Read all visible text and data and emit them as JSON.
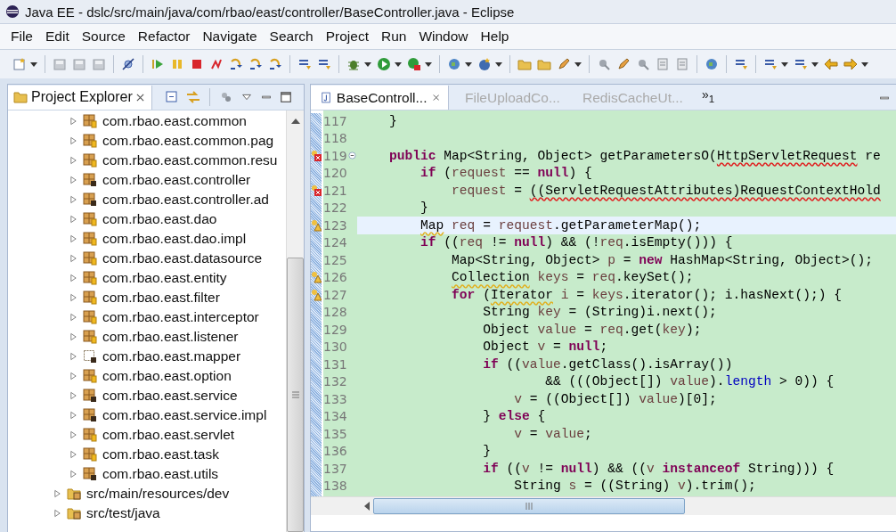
{
  "window": {
    "title": "Java EE - dslc/src/main/java/com/rbao/east/controller/BaseController.java - Eclipse"
  },
  "menu": [
    "File",
    "Edit",
    "Source",
    "Refactor",
    "Navigate",
    "Search",
    "Project",
    "Run",
    "Window",
    "Help"
  ],
  "left_panel": {
    "tab": {
      "label": "Project Explorer",
      "selected": true
    },
    "packages": [
      {
        "label": "com.rbao.east.common",
        "kind": "package",
        "expanded": false
      },
      {
        "label": "com.rbao.east.common.pag",
        "kind": "package",
        "expanded": false
      },
      {
        "label": "com.rbao.east.common.resu",
        "kind": "package",
        "expanded": false
      },
      {
        "label": "com.rbao.east.controller",
        "kind": "package-marked",
        "expanded": false
      },
      {
        "label": "com.rbao.east.controller.ad",
        "kind": "package-marked",
        "expanded": false
      },
      {
        "label": "com.rbao.east.dao",
        "kind": "package",
        "expanded": false
      },
      {
        "label": "com.rbao.east.dao.impl",
        "kind": "package",
        "expanded": false
      },
      {
        "label": "com.rbao.east.datasource",
        "kind": "package",
        "expanded": false
      },
      {
        "label": "com.rbao.east.entity",
        "kind": "package",
        "expanded": false
      },
      {
        "label": "com.rbao.east.filter",
        "kind": "package",
        "expanded": false
      },
      {
        "label": "com.rbao.east.interceptor",
        "kind": "package",
        "expanded": false
      },
      {
        "label": "com.rbao.east.listener",
        "kind": "package",
        "expanded": false
      },
      {
        "label": "com.rbao.east.mapper",
        "kind": "package-empty",
        "expanded": false
      },
      {
        "label": "com.rbao.east.option",
        "kind": "package",
        "expanded": false
      },
      {
        "label": "com.rbao.east.service",
        "kind": "package-marked",
        "expanded": false
      },
      {
        "label": "com.rbao.east.service.impl",
        "kind": "package-marked",
        "expanded": false
      },
      {
        "label": "com.rbao.east.servlet",
        "kind": "package",
        "expanded": false
      },
      {
        "label": "com.rbao.east.task",
        "kind": "package",
        "expanded": false
      },
      {
        "label": "com.rbao.east.utils",
        "kind": "package-marked",
        "expanded": false
      }
    ],
    "source_folders": [
      {
        "label": "src/main/resources/dev",
        "expanded": false
      },
      {
        "label": "src/test/java",
        "expanded": false
      }
    ]
  },
  "editor": {
    "tabs": [
      {
        "label": "BaseControll...",
        "selected": true
      },
      {
        "label": "FileUploadCo...",
        "selected": false
      },
      {
        "label": "RedisCacheUt...",
        "selected": false
      }
    ],
    "overflow": "»$_{1}$",
    "lines": [
      {
        "number": "117",
        "current": false,
        "tokens": [
          {
            "text": "    }",
            "kind": "plain"
          }
        ]
      },
      {
        "number": "118",
        "current": false
      },
      {
        "number": "119",
        "current": false,
        "kind": "error",
        "expanded": true,
        "tokens": [
          {
            "text": "    public",
            "kind": "kw"
          },
          {
            "text": " Map<String, Object> getParametersO(",
            "kind": "plain"
          },
          {
            "text": "HttpServletRequest",
            "kind": "err"
          },
          {
            "text": " re",
            "kind": "plain"
          }
        ]
      },
      {
        "number": "120",
        "current": false,
        "tokens": [
          {
            "text": "        if",
            "kind": "kw"
          },
          {
            "text": " (",
            "kind": "plain"
          },
          {
            "text": "request",
            "kind": "var"
          },
          {
            "text": " == ",
            "kind": "plain"
          },
          {
            "text": "null",
            "kind": "kw"
          },
          {
            "text": ") {",
            "kind": "plain"
          }
        ]
      },
      {
        "number": "121",
        "current": false,
        "kind": "error",
        "tokens": [
          {
            "text": "            request",
            "kind": "var"
          },
          {
            "text": " = ",
            "kind": "plain"
          },
          {
            "text": "((ServletRequestAttributes)RequestContextHold",
            "kind": "err"
          }
        ]
      },
      {
        "number": "122",
        "current": false,
        "tokens": [
          {
            "text": "        }",
            "kind": "plain"
          }
        ]
      },
      {
        "number": "123",
        "current": true,
        "kind": "warning",
        "tokens": [
          {
            "text": "        Map",
            "kind": "warn"
          },
          {
            "text": " req",
            "kind": "var"
          },
          {
            "text": " = ",
            "kind": "plain"
          },
          {
            "text": "request",
            "kind": "var"
          },
          {
            "text": ".getParameterMap();",
            "kind": "plain"
          }
        ]
      },
      {
        "number": "124",
        "current": false,
        "tokens": [
          {
            "text": "        if",
            "kind": "kw"
          },
          {
            "text": " ((",
            "kind": "plain"
          },
          {
            "text": "req",
            "kind": "var"
          },
          {
            "text": " != ",
            "kind": "plain"
          },
          {
            "text": "null",
            "kind": "kw"
          },
          {
            "text": ") && (!",
            "kind": "plain"
          },
          {
            "text": "req",
            "kind": "var"
          },
          {
            "text": ".isEmpty())) {",
            "kind": "plain"
          }
        ]
      },
      {
        "number": "125",
        "current": false,
        "tokens": [
          {
            "text": "            Map<String, Object> ",
            "kind": "plain"
          },
          {
            "text": "p",
            "kind": "var"
          },
          {
            "text": " = ",
            "kind": "plain"
          },
          {
            "text": "new",
            "kind": "kw"
          },
          {
            "text": " HashMap<String, Object>();",
            "kind": "plain"
          }
        ]
      },
      {
        "number": "126",
        "current": false,
        "kind": "warning",
        "tokens": [
          {
            "text": "            Collection",
            "kind": "warn"
          },
          {
            "text": " keys",
            "kind": "var"
          },
          {
            "text": " = ",
            "kind": "plain"
          },
          {
            "text": "req",
            "kind": "var"
          },
          {
            "text": ".keySet();",
            "kind": "plain"
          }
        ]
      },
      {
        "number": "127",
        "current": false,
        "kind": "warning",
        "tokens": [
          {
            "text": "            for",
            "kind": "kw"
          },
          {
            "text": " (",
            "kind": "plain"
          },
          {
            "text": "Iterator",
            "kind": "warn"
          },
          {
            "text": " i",
            "kind": "var"
          },
          {
            "text": " = ",
            "kind": "plain"
          },
          {
            "text": "keys",
            "kind": "var"
          },
          {
            "text": ".iterator(); i.hasNext();) {",
            "kind": "plain"
          }
        ]
      },
      {
        "number": "128",
        "current": false,
        "tokens": [
          {
            "text": "                String ",
            "kind": "plain"
          },
          {
            "text": "key",
            "kind": "var"
          },
          {
            "text": " = (String)i.next();",
            "kind": "plain"
          }
        ]
      },
      {
        "number": "129",
        "current": false,
        "tokens": [
          {
            "text": "                Object ",
            "kind": "plain"
          },
          {
            "text": "value",
            "kind": "var"
          },
          {
            "text": " = ",
            "kind": "plain"
          },
          {
            "text": "req",
            "kind": "var"
          },
          {
            "text": ".get(",
            "kind": "plain"
          },
          {
            "text": "key",
            "kind": "var"
          },
          {
            "text": ");",
            "kind": "plain"
          }
        ]
      },
      {
        "number": "130",
        "current": false,
        "tokens": [
          {
            "text": "                Object ",
            "kind": "plain"
          },
          {
            "text": "v",
            "kind": "var"
          },
          {
            "text": " = ",
            "kind": "plain"
          },
          {
            "text": "null",
            "kind": "kw"
          },
          {
            "text": ";",
            "kind": "plain"
          }
        ]
      },
      {
        "number": "131",
        "current": false,
        "tokens": [
          {
            "text": "                if",
            "kind": "kw"
          },
          {
            "text": " ((",
            "kind": "plain"
          },
          {
            "text": "value",
            "kind": "var"
          },
          {
            "text": ".getClass().isArray())",
            "kind": "plain"
          }
        ]
      },
      {
        "number": "132",
        "current": false,
        "tokens": [
          {
            "text": "                        && (((Object[]) ",
            "kind": "plain"
          },
          {
            "text": "value",
            "kind": "var"
          },
          {
            "text": ").",
            "kind": "plain"
          },
          {
            "text": "length",
            "kind": "field"
          },
          {
            "text": " > 0)) {",
            "kind": "plain"
          }
        ]
      },
      {
        "number": "133",
        "current": false,
        "tokens": [
          {
            "text": "                    v",
            "kind": "var"
          },
          {
            "text": " = ((Object[]) ",
            "kind": "plain"
          },
          {
            "text": "value",
            "kind": "var"
          },
          {
            "text": ")[0];",
            "kind": "plain"
          }
        ]
      },
      {
        "number": "134",
        "current": false,
        "tokens": [
          {
            "text": "                } ",
            "kind": "plain"
          },
          {
            "text": "else",
            "kind": "kw"
          },
          {
            "text": " {",
            "kind": "plain"
          }
        ]
      },
      {
        "number": "135",
        "current": false,
        "tokens": [
          {
            "text": "                    v",
            "kind": "var"
          },
          {
            "text": " = ",
            "kind": "plain"
          },
          {
            "text": "value",
            "kind": "var"
          },
          {
            "text": ";",
            "kind": "plain"
          }
        ]
      },
      {
        "number": "136",
        "current": false,
        "tokens": [
          {
            "text": "                }",
            "kind": "plain"
          }
        ]
      },
      {
        "number": "137",
        "current": false,
        "tokens": [
          {
            "text": "                if",
            "kind": "kw"
          },
          {
            "text": " ((",
            "kind": "plain"
          },
          {
            "text": "v",
            "kind": "var"
          },
          {
            "text": " != ",
            "kind": "plain"
          },
          {
            "text": "null",
            "kind": "kw"
          },
          {
            "text": ") && ((",
            "kind": "plain"
          },
          {
            "text": "v",
            "kind": "var"
          },
          {
            "text": " instanceof",
            "kind": "kw"
          },
          {
            "text": " String))) {",
            "kind": "plain"
          }
        ]
      },
      {
        "number": "138",
        "current": false,
        "tokens": [
          {
            "text": "                    String ",
            "kind": "plain"
          },
          {
            "text": "s",
            "kind": "var"
          },
          {
            "text": " = ((String) ",
            "kind": "plain"
          },
          {
            "text": "v",
            "kind": "var"
          },
          {
            "text": ").trim();",
            "kind": "plain"
          }
        ]
      }
    ]
  }
}
